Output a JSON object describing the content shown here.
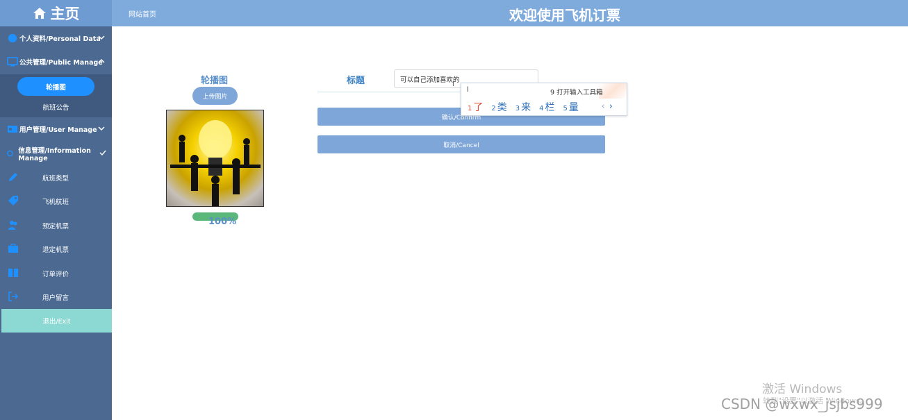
{
  "header": {
    "brand": "主页",
    "home_link": "网站首页",
    "title": "欢迎使用飞机订票"
  },
  "sidebar": {
    "groups": [
      {
        "label": "个人资料/Personal Data",
        "icon": "user-circle-icon",
        "expanded": false
      },
      {
        "label": "公共管理/Public Manage",
        "icon": "monitor-icon",
        "expanded": true,
        "children": [
          "轮播图",
          "航班公告"
        ]
      },
      {
        "label": "用户管理/User Manage",
        "icon": "id-card-icon",
        "expanded": false
      },
      {
        "label": "信息管理/Information Manage",
        "icon": "info-icon",
        "expanded": true
      }
    ],
    "active_child": "轮播图",
    "second_child": "航班公告",
    "items": [
      {
        "label": "航班类型",
        "icon": "pencil-icon"
      },
      {
        "label": "飞机航班",
        "icon": "tag-icon"
      },
      {
        "label": "预定机票",
        "icon": "users-icon"
      },
      {
        "label": "退定机票",
        "icon": "briefcase-icon"
      },
      {
        "label": "订单评价",
        "icon": "book-icon"
      },
      {
        "label": "用户留言",
        "icon": "sign-out-icon"
      }
    ],
    "exit": "退出/Exit",
    "colors": {
      "sidebar_bg": "#4c6a91",
      "active": "#1e90ff",
      "exit_bg": "#8cd8d2"
    }
  },
  "form": {
    "carousel_label": "轮播图",
    "upload_button": "上传图片",
    "progress_text": "100%",
    "progress": 100,
    "title_label": "标题",
    "title_value": "可以自己添加喜欢的",
    "confirm_button": "确认/Confirm",
    "cancel_button": "取消/Cancel"
  },
  "ime": {
    "composition": "l",
    "toolbox": "9 打开输入工具箱",
    "candidates": [
      {
        "num": "1",
        "text": "了"
      },
      {
        "num": "2",
        "text": "类"
      },
      {
        "num": "3",
        "text": "来"
      },
      {
        "num": "4",
        "text": "栏"
      },
      {
        "num": "5",
        "text": "量"
      }
    ]
  },
  "watermark": {
    "windows": "激活 Windows",
    "windows_sub": "转到\"设置\"以激活 Windows。",
    "csdn": "CSDN @wxwx_jsjbs999"
  }
}
